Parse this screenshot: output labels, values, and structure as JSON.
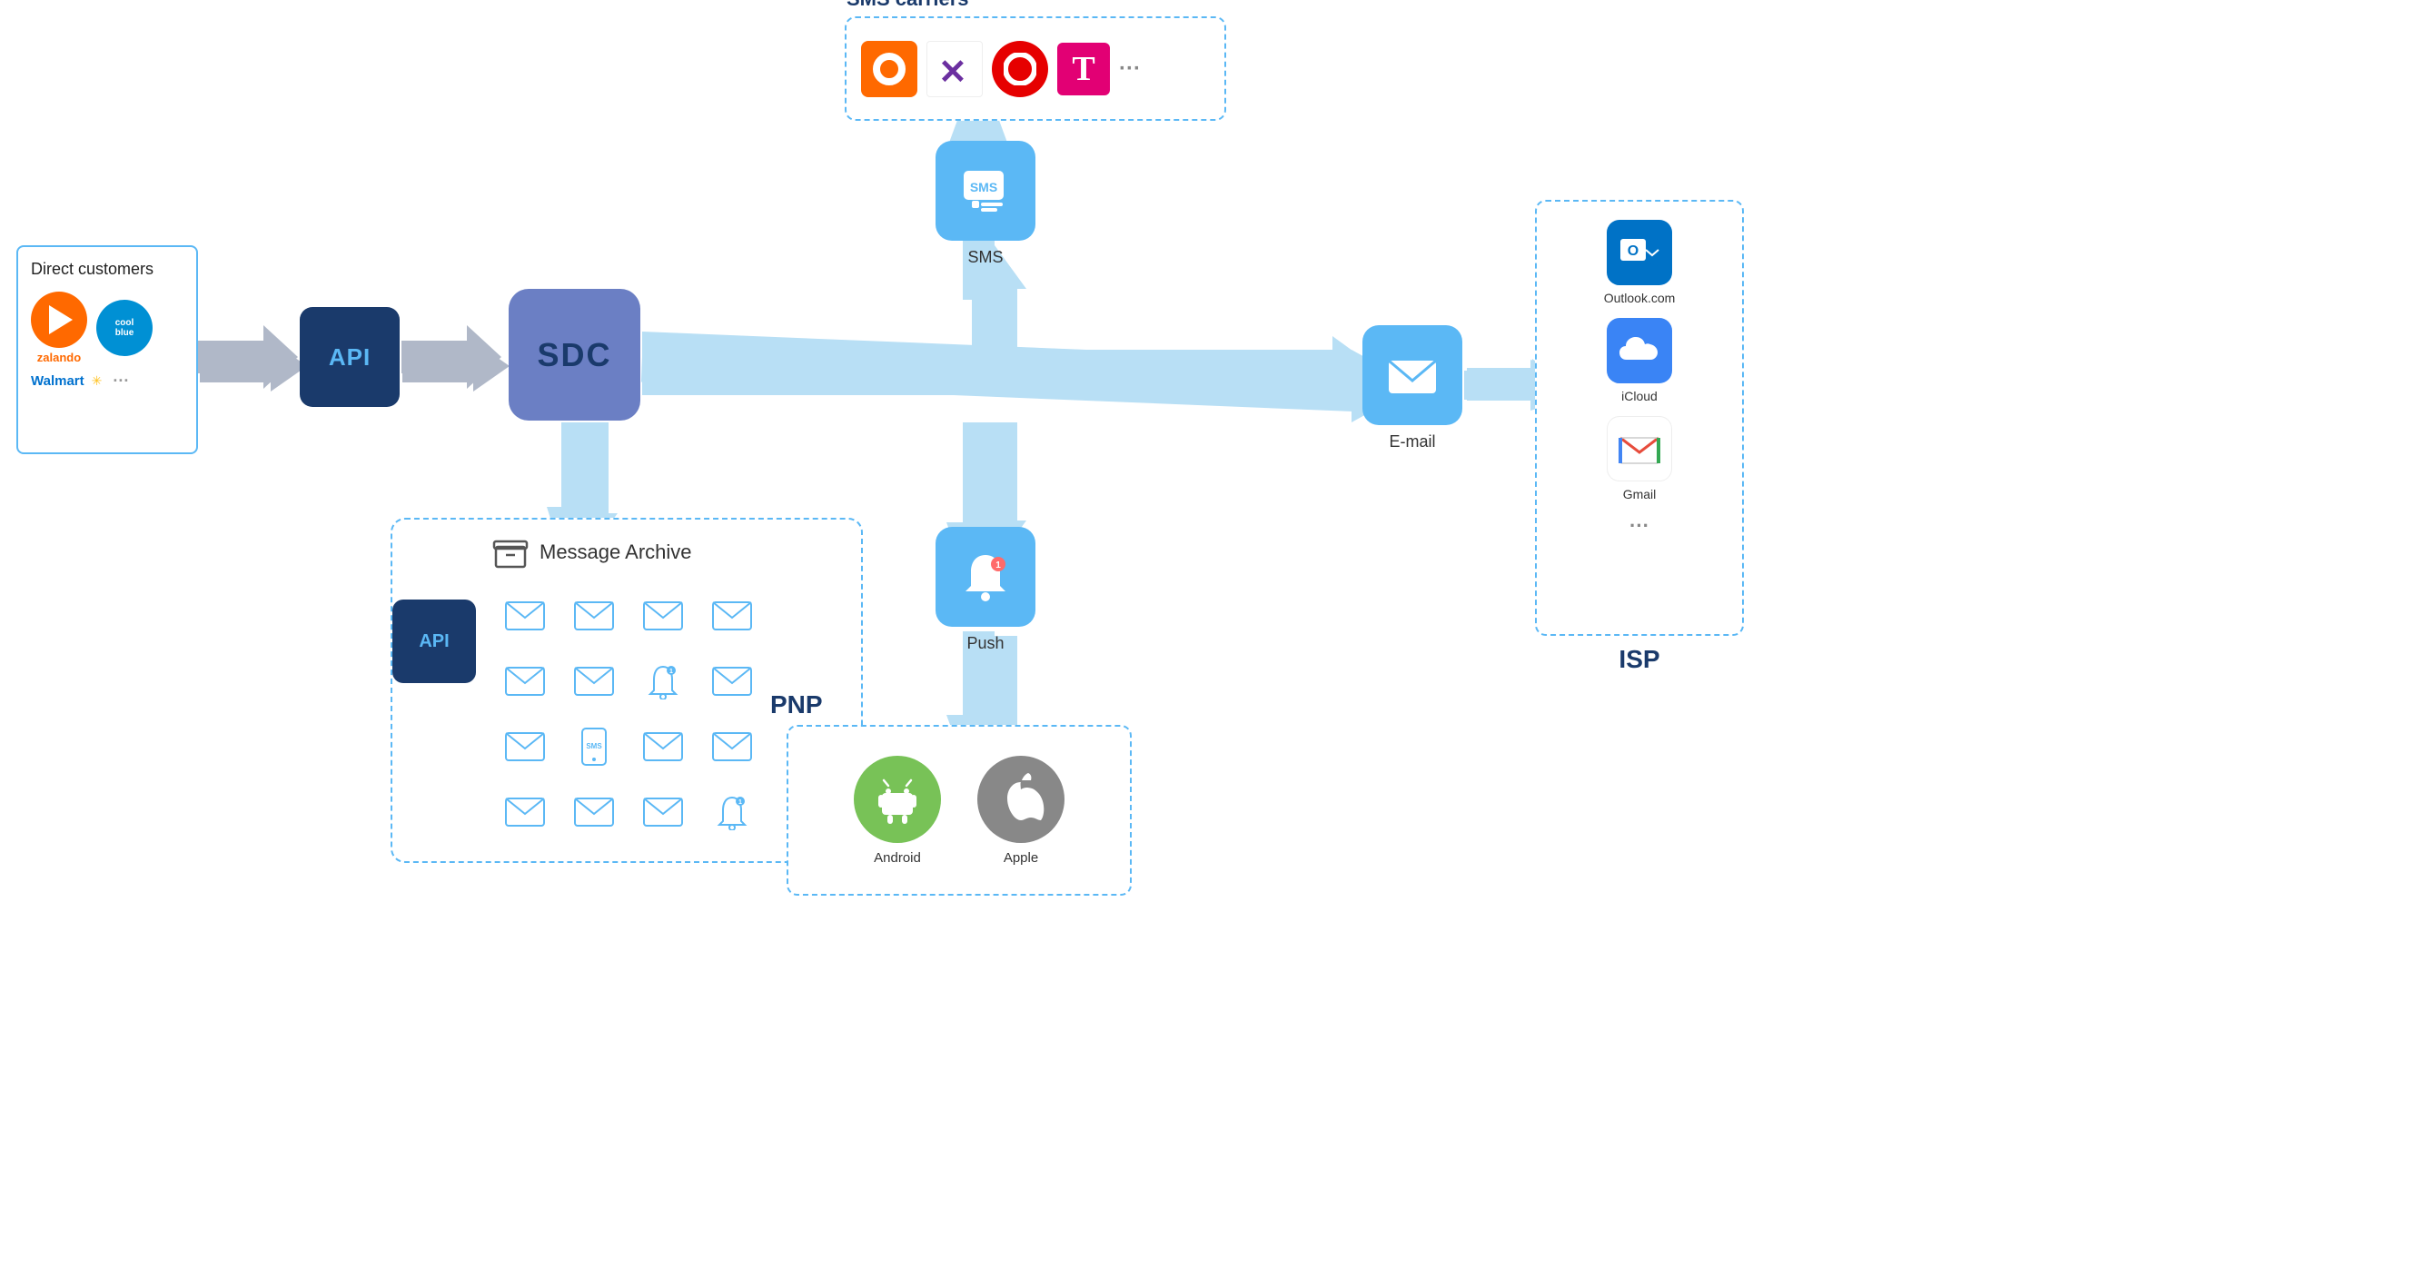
{
  "direct_customers": {
    "title": "Direct customers",
    "logos": [
      {
        "name": "zalando",
        "color": "#ff6900",
        "label": "zalando"
      },
      {
        "name": "coolblue",
        "color": "#0090d4",
        "label": "cool blue"
      },
      {
        "name": "walmart",
        "label": "Walmart"
      },
      {
        "name": "dots",
        "label": "..."
      }
    ]
  },
  "api": {
    "label": "API"
  },
  "sdc": {
    "label": "SDC"
  },
  "sms_carriers": {
    "title": "SMS carriers",
    "logos": [
      "orange",
      "proximus",
      "vodafone",
      "t-mobile"
    ],
    "dots": "..."
  },
  "sms": {
    "label": "SMS"
  },
  "email": {
    "label": "E-mail"
  },
  "push": {
    "label": "Push"
  },
  "message_archive": {
    "title": "Message Archive",
    "api_label": "API"
  },
  "isp": {
    "title": "ISP",
    "items": [
      {
        "label": "Outlook.com"
      },
      {
        "label": "iCloud"
      },
      {
        "label": "Gmail"
      },
      {
        "label": "..."
      }
    ]
  },
  "pnp": {
    "title": "PNP",
    "items": [
      {
        "label": "Android"
      },
      {
        "label": "Apple"
      }
    ]
  }
}
